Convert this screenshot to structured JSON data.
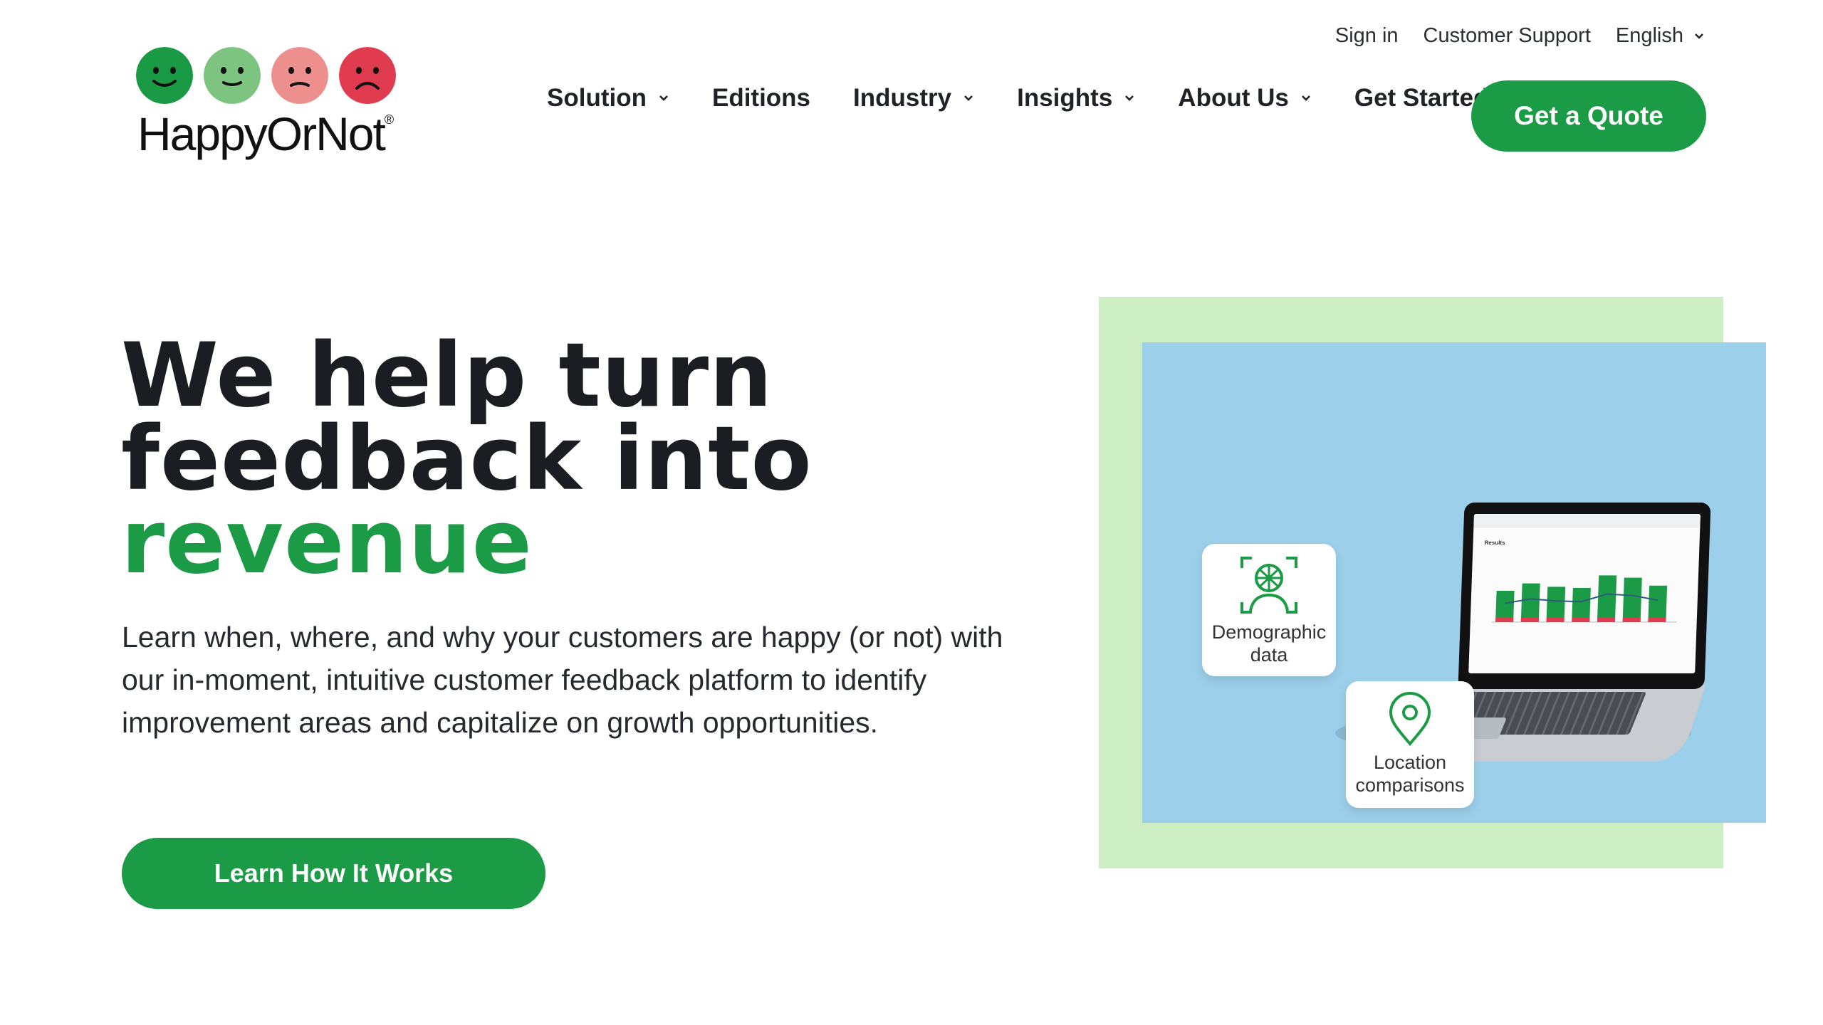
{
  "header": {
    "brand": "HappyOrNot",
    "brand_mark": "®",
    "faces": [
      {
        "icon": "very-happy-face-icon",
        "color": "#1a9a45"
      },
      {
        "icon": "happy-face-icon",
        "color": "#7cc47f"
      },
      {
        "icon": "unhappy-face-icon",
        "color": "#ec8f8d"
      },
      {
        "icon": "very-unhappy-face-icon",
        "color": "#e13b4f"
      }
    ],
    "utility": {
      "sign_in": "Sign in",
      "support": "Customer Support",
      "language": "English"
    },
    "nav": [
      {
        "label": "Solution",
        "dropdown": true
      },
      {
        "label": "Editions",
        "dropdown": false
      },
      {
        "label": "Industry",
        "dropdown": true
      },
      {
        "label": "Insights",
        "dropdown": true
      },
      {
        "label": "About Us",
        "dropdown": true
      },
      {
        "label": "Get Started",
        "dropdown": false
      }
    ],
    "cta": "Get a Quote"
  },
  "hero": {
    "title_line1": "We help turn",
    "title_line2": "feedback into",
    "title_accent": "revenue",
    "description": "Learn when, where, and why your customers are happy (or not) with our in-moment, intuitive customer feedback platform to identify improvement areas and capitalize on growth opportunities.",
    "button": "Learn How It Works"
  },
  "illustration": {
    "card_demographic": "Demographic data",
    "card_location": "Location comparisons",
    "screen_title": "Results"
  },
  "colors": {
    "accent": "#1b9b45",
    "frame_green": "#cdedc2",
    "frame_blue": "#9ccfea"
  },
  "chart_data": {
    "type": "bar",
    "values": [
      55,
      68,
      62,
      60,
      82,
      78,
      64
    ]
  }
}
